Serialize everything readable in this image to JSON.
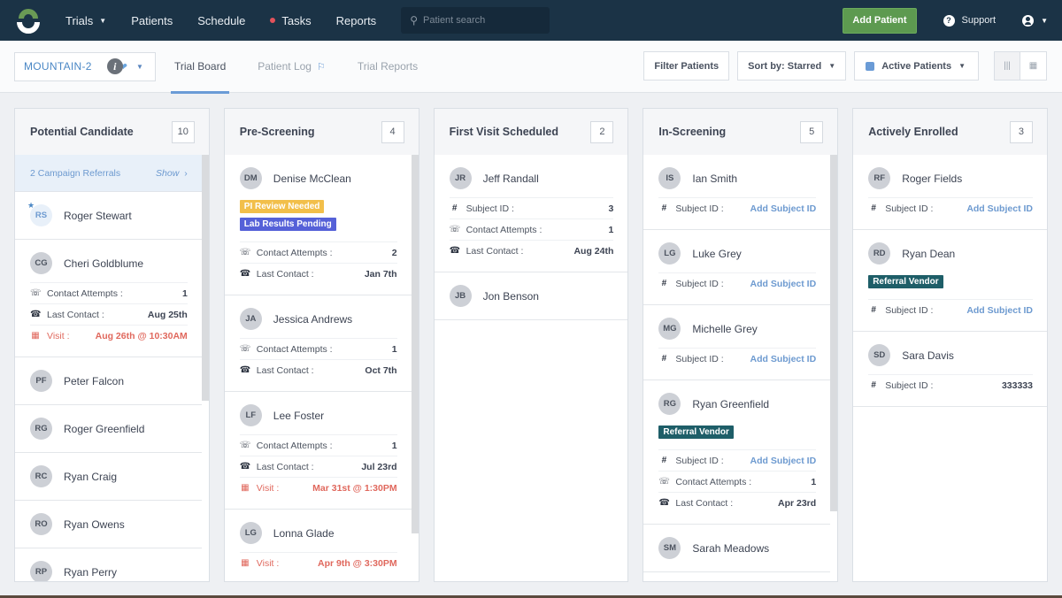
{
  "nav": {
    "items": [
      {
        "label": "Trials",
        "has_caret": true
      },
      {
        "label": "Patients"
      },
      {
        "label": "Schedule"
      },
      {
        "label": "Tasks",
        "has_dot": true
      },
      {
        "label": "Reports"
      }
    ],
    "search_placeholder": "Patient search",
    "add_patient_label": "Add Patient",
    "support_label": "Support",
    "colors": {
      "nav_bg": "#1b3346",
      "add_patient": "#5d9a50",
      "task_dot": "#e3525b"
    }
  },
  "subbar": {
    "trial_name": "MOUNTAIN-2",
    "tabs": [
      {
        "label": "Trial Board",
        "active": true
      },
      {
        "label": "Patient Log",
        "icon": "flag-icon"
      },
      {
        "label": "Trial Reports"
      }
    ],
    "filter_label": "Filter Patients",
    "sort_label": "Sort by: Starred",
    "status_label": "Active Patients",
    "view_modes": [
      "columns-view",
      "table-view"
    ]
  },
  "board": {
    "columns": [
      {
        "title": "Potential Candidate",
        "count": "10",
        "referral": {
          "text": "2 Campaign Referrals",
          "action": "Show"
        },
        "cards": [
          {
            "initials": "RS",
            "name": "Roger Stewart",
            "starred": true
          },
          {
            "initials": "CG",
            "name": "Cheri Goldblume",
            "fields": [
              {
                "icon": "headset",
                "label": "Contact Attempts",
                "value": "1"
              },
              {
                "icon": "phone",
                "label": "Last Contact",
                "value": "Aug 25th"
              },
              {
                "icon": "calendar",
                "label": "Visit",
                "value": "Aug 26th @ 10:30AM",
                "visit": true
              }
            ]
          },
          {
            "initials": "PF",
            "name": "Peter Falcon"
          },
          {
            "initials": "RG",
            "name": "Roger Greenfield"
          },
          {
            "initials": "RC",
            "name": "Ryan Craig"
          },
          {
            "initials": "RO",
            "name": "Ryan Owens"
          },
          {
            "initials": "RP",
            "name": "Ryan Perry"
          }
        ]
      },
      {
        "title": "Pre-Screening",
        "count": "4",
        "cards": [
          {
            "initials": "DM",
            "name": "Denise McClean",
            "tags": [
              {
                "label": "PI Review Needed",
                "color": "yellow"
              },
              {
                "label": "Lab Results Pending",
                "color": "indigo"
              }
            ],
            "fields": [
              {
                "icon": "headset",
                "label": "Contact Attempts",
                "value": "2"
              },
              {
                "icon": "phone",
                "label": "Last Contact",
                "value": "Jan 7th"
              }
            ]
          },
          {
            "initials": "JA",
            "name": "Jessica Andrews",
            "fields": [
              {
                "icon": "headset",
                "label": "Contact Attempts",
                "value": "1"
              },
              {
                "icon": "phone",
                "label": "Last Contact",
                "value": "Oct 7th"
              }
            ]
          },
          {
            "initials": "LF",
            "name": "Lee Foster",
            "fields": [
              {
                "icon": "headset",
                "label": "Contact Attempts",
                "value": "1"
              },
              {
                "icon": "phone",
                "label": "Last Contact",
                "value": "Jul 23rd"
              },
              {
                "icon": "calendar",
                "label": "Visit",
                "value": "Mar 31st @ 1:30PM",
                "visit": true
              }
            ]
          },
          {
            "initials": "LG",
            "name": "Lonna Glade",
            "fields": [
              {
                "icon": "calendar",
                "label": "Visit",
                "value": "Apr 9th @ 3:30PM",
                "visit": true
              }
            ]
          }
        ]
      },
      {
        "title": "First Visit Scheduled",
        "count": "2",
        "cards": [
          {
            "initials": "JR",
            "name": "Jeff Randall",
            "fields": [
              {
                "icon": "hash",
                "label": "Subject ID",
                "value": "3"
              },
              {
                "icon": "headset",
                "label": "Contact Attempts",
                "value": "1"
              },
              {
                "icon": "phone",
                "label": "Last Contact",
                "value": "Aug 24th"
              }
            ]
          },
          {
            "initials": "JB",
            "name": "Jon Benson"
          }
        ]
      },
      {
        "title": "In-Screening",
        "count": "5",
        "cards": [
          {
            "initials": "IS",
            "name": "Ian Smith",
            "fields": [
              {
                "icon": "hash",
                "label": "Subject ID",
                "value": "Add Subject ID",
                "link": true
              }
            ]
          },
          {
            "initials": "LG",
            "name": "Luke Grey",
            "fields": [
              {
                "icon": "hash",
                "label": "Subject ID",
                "value": "Add Subject ID",
                "link": true
              }
            ]
          },
          {
            "initials": "MG",
            "name": "Michelle Grey",
            "fields": [
              {
                "icon": "hash",
                "label": "Subject ID",
                "value": "Add Subject ID",
                "link": true
              }
            ]
          },
          {
            "initials": "RG",
            "name": "Ryan Greenfield",
            "tags": [
              {
                "label": "Referral Vendor",
                "color": "teal"
              }
            ],
            "fields": [
              {
                "icon": "hash",
                "label": "Subject ID",
                "value": "Add Subject ID",
                "link": true
              },
              {
                "icon": "headset",
                "label": "Contact Attempts",
                "value": "1"
              },
              {
                "icon": "phone",
                "label": "Last Contact",
                "value": "Apr 23rd"
              }
            ]
          },
          {
            "initials": "SM",
            "name": "Sarah Meadows"
          }
        ]
      },
      {
        "title": "Actively Enrolled",
        "count": "3",
        "cards": [
          {
            "initials": "RF",
            "name": "Roger Fields",
            "fields": [
              {
                "icon": "hash",
                "label": "Subject ID",
                "value": "Add Subject ID",
                "link": true
              }
            ]
          },
          {
            "initials": "RD",
            "name": "Ryan Dean",
            "tags": [
              {
                "label": "Referral Vendor",
                "color": "teal"
              }
            ],
            "fields": [
              {
                "icon": "hash",
                "label": "Subject ID",
                "value": "Add Subject ID",
                "link": true
              }
            ]
          },
          {
            "initials": "SD",
            "name": "Sara Davis",
            "fields": [
              {
                "icon": "hash",
                "label": "Subject ID",
                "value": "333333"
              }
            ]
          }
        ]
      }
    ]
  }
}
